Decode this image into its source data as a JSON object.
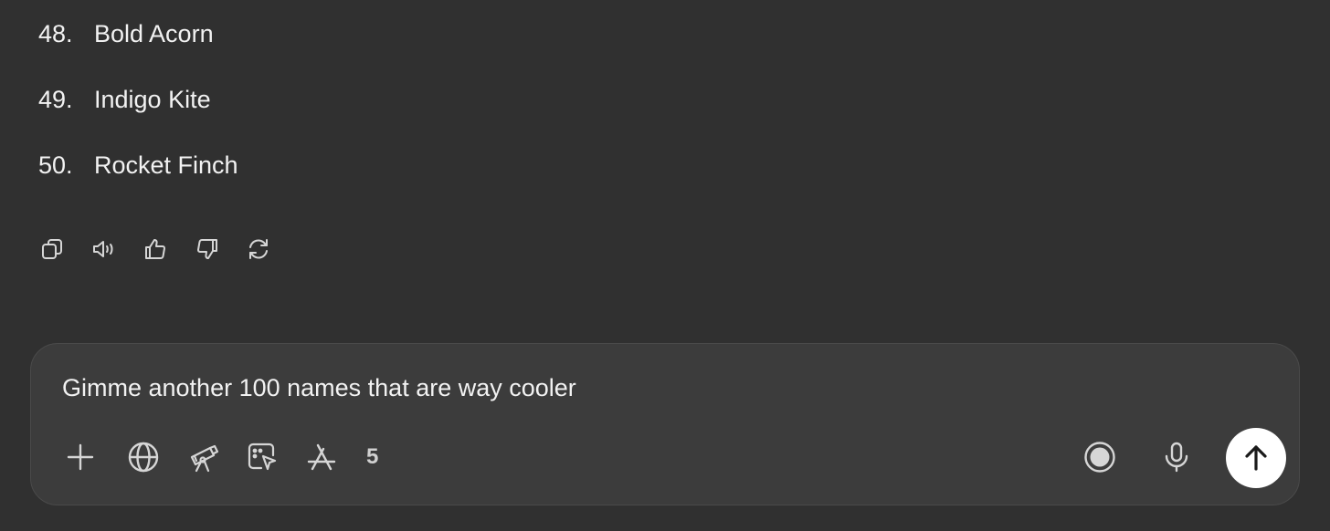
{
  "conversation": {
    "list_items": [
      {
        "number": "48.",
        "text": "Bold Acorn"
      },
      {
        "number": "49.",
        "text": "Indigo Kite"
      },
      {
        "number": "50.",
        "text": "Rocket Finch"
      }
    ],
    "message_actions": [
      {
        "icon": "copy-icon"
      },
      {
        "icon": "read-aloud-icon"
      },
      {
        "icon": "thumbs-up-icon"
      },
      {
        "icon": "thumbs-down-icon"
      },
      {
        "icon": "regenerate-icon"
      }
    ]
  },
  "composer": {
    "input_text": "Gimme another 100 names that are way cooler",
    "tools": [
      {
        "icon": "plus-icon"
      },
      {
        "icon": "globe-icon"
      },
      {
        "icon": "telescope-icon"
      },
      {
        "icon": "canvas-cursor-icon"
      },
      {
        "icon": "app-store-icon"
      }
    ],
    "tool_count": "5",
    "right_icons": [
      {
        "icon": "voice-mode-icon"
      },
      {
        "icon": "microphone-icon"
      },
      {
        "icon": "send-arrow-icon"
      }
    ]
  },
  "colors": {
    "background": "#303030",
    "composer_background": "#3c3c3c",
    "text": "#f2f2f2",
    "icon": "#d6d6d6",
    "send_button": "#ffffff"
  }
}
